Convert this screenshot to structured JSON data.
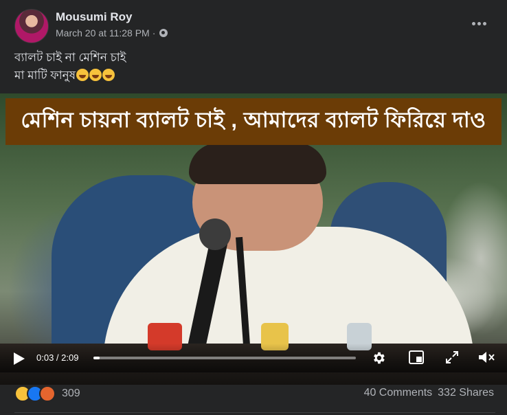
{
  "post": {
    "author": "Mousumi Roy",
    "timestamp": "March 20 at 11:28 PM",
    "separator": "·",
    "privacy_icon": "globe-icon",
    "caption_line1": "ব্যালট চাই না মেশিন চাই",
    "caption_line2": "মা মাটি ফানুষ",
    "caption_emojis": [
      "laughing-emoji",
      "laughing-emoji",
      "laughing-emoji"
    ]
  },
  "video": {
    "banner_text": "মেশিন চায়না ব্যালট চাই , আমাদের ব্যালট ফিরিয়ে দাও",
    "current_time": "0:03",
    "duration": "2:09",
    "time_display": "0:03 / 2:09",
    "progress_fraction": 0.023,
    "icons": {
      "play": "play-icon",
      "settings": "gear-icon",
      "pip": "picture-in-picture-icon",
      "fullscreen": "expand-icon",
      "volume": "mute-icon"
    }
  },
  "footer": {
    "reactions": [
      "haha-reaction-icon",
      "like-reaction-icon",
      "angry-reaction-icon"
    ],
    "reaction_count": "309",
    "comments": "40 Comments",
    "shares": "332 Shares"
  },
  "colors": {
    "background": "#242526",
    "text_primary": "#e4e6eb",
    "text_secondary": "#b0b3b8",
    "banner_bg": "#6b3c06",
    "like_blue": "#1877f2"
  }
}
